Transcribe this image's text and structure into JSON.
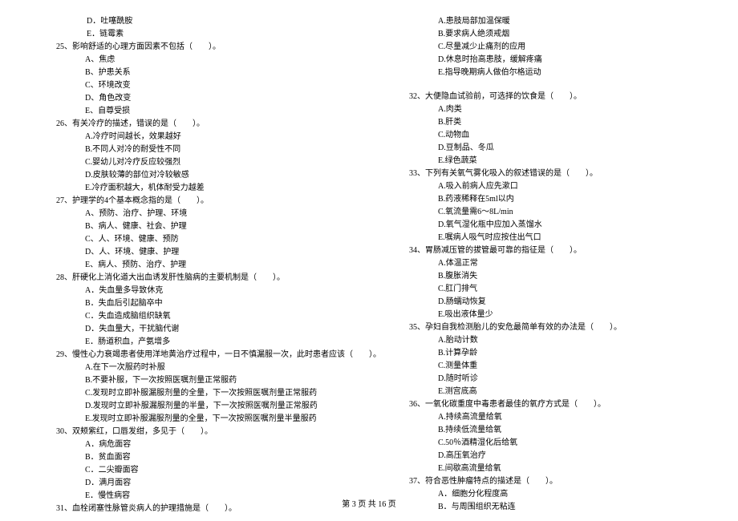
{
  "col1": {
    "pre_opts": [
      "D．吐噻酰胺",
      "E．链霉素"
    ],
    "q25": {
      "stem": "25、影响舒适的心理方面因素不包括（　　）。",
      "opts": [
        "A、焦虑",
        "B、护患关系",
        "C、环境改变",
        "D、角色改变",
        "E、自尊受损"
      ]
    },
    "q26": {
      "stem": "26、有关冷疗的描述，错误的是（　　）。",
      "opts": [
        "A.冷疗时间越长，效果越好",
        "B.不同人对冷的耐受性不同",
        "C.婴幼儿对冷疗反应较强烈",
        "D.皮肤较薄的部位对冷较敏感",
        "E.冷疗面积越大，机体耐受力越差"
      ]
    },
    "q27": {
      "stem": "27、护理学的4个基本概念指的是（　　）。",
      "opts": [
        "A、预防、治疗、护理、环境",
        "B、病人、健康、社会、护理",
        "C、人、环境、健康、预防",
        "D、人、环境、健康、护理",
        "E、病人、预防、治疗、护理"
      ]
    },
    "q28": {
      "stem": "28、肝硬化上消化道大出血诱发肝性脑病的主要机制是（　　）。",
      "opts": [
        "A．失血量多导致休克",
        "B．失血后引起脑卒中",
        "C．失血造成脑组织缺氧",
        "D．失血量大，干扰脑代谢",
        "E．肠道积血，产氨增多"
      ]
    },
    "q29": {
      "stem": "29、慢性心力衰竭患者使用洋地黄治疗过程中，一日不慎漏服一次，此时患者应该（　　）。",
      "opts": [
        "A.在下一次服药时补服",
        "B.不要补服，下一次按照医嘱剂量正常服药",
        "C.发现时立即补服漏服剂量的全量，下一次按照医嘱剂量正常服药",
        "D.发现时立即补服漏服剂量的半量，下一次按照医嘱剂量正常服药",
        "E.发现时立即补服漏服剂量的全量，下一次按照医嘱剂量半量服药"
      ]
    },
    "q30": {
      "stem": "30、双颊紫红，口唇发绀，多见于（　　）。",
      "opts": [
        "A．病危面容",
        "B．贫血面容",
        "C．二尖瓣面容",
        "D．满月面容",
        "E．慢性病容"
      ]
    },
    "q31": {
      "stem": "31、血栓闭塞性脉管炎病人的护理措施是（　　）。"
    }
  },
  "col2": {
    "pre_opts": [
      "A.患肢局部加温保暖",
      "B.要求病人绝须戒烟",
      "C.尽量减少止痛剂的应用",
      "D.休息时抬高患肢，缓解疼痛",
      "E.指导晚期病人做伯尔格运动"
    ],
    "q32": {
      "stem": "32、大便隐血试验前，可选择的饮食是（　　）。",
      "opts": [
        "A.肉类",
        "B.肝类",
        "C.动物血",
        "D.豆制品、冬瓜",
        "E.绿色蔬菜"
      ]
    },
    "q33": {
      "stem": "33、下列有关氧气雾化吸入的叙述错误的是（　　）。",
      "opts": [
        "A.吸入前病人应先漱口",
        "B.药液稀释在5ml以内",
        "C.氧流量需6～8L/min",
        "D.氧气湿化瓶中应加入蒸馏水",
        "E.嘱病人吸气时应按住出气口"
      ]
    },
    "q34": {
      "stem": "34、胃肠减压管的拔管最可靠的指征是（　　）。",
      "opts": [
        "A.体温正常",
        "B.腹胀消失",
        "C.肛门排气",
        "D.肠蠕动恢复",
        "E.吸出液体量少"
      ]
    },
    "q35": {
      "stem": "35、孕妇自我检测胎儿的安危最简单有效的办法是（　　）。",
      "opts": [
        "A.胎动计数",
        "B.计算孕龄",
        "C.测量体重",
        "D.随时听诊",
        "E.测宫底高"
      ]
    },
    "q36": {
      "stem": "36、一氧化碳重度中毒患者最佳的氧疗方式是（　　）。",
      "opts": [
        "A.持续高流量给氧",
        "B.持续低流量给氧",
        "C.50％酒精湿化后给氧",
        "D.高压氧治疗",
        "E.间歇高流量给氧"
      ]
    },
    "q37": {
      "stem": "37、符合恶性肿瘤特点的描述是（　　）。",
      "opts": [
        "A．细胞分化程度高",
        "B．与周围组织无粘连"
      ]
    }
  },
  "footer": "第 3 页 共 16 页"
}
